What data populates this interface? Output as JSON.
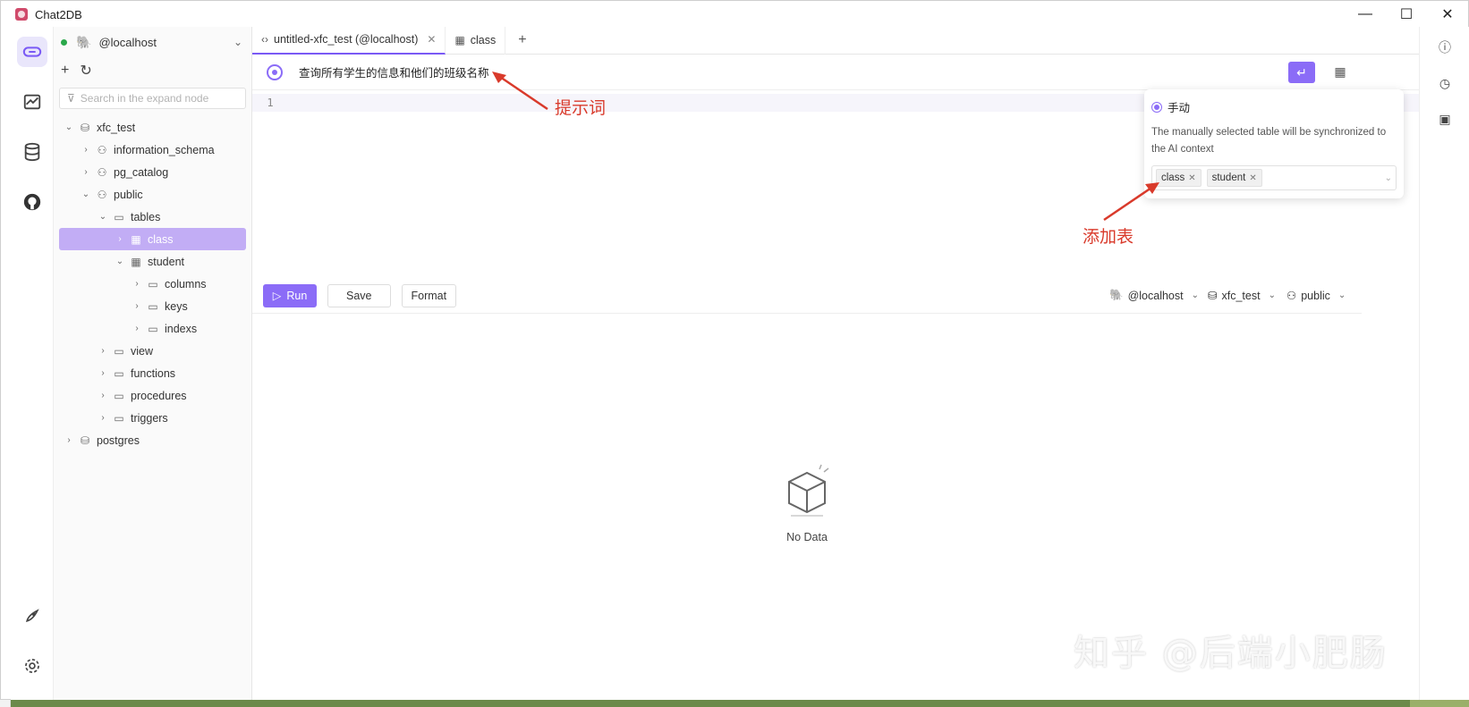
{
  "window": {
    "title": "Chat2DB",
    "minimize": "—",
    "maximize": "☐",
    "close": "✕"
  },
  "sidebar": {
    "connection": "@localhost",
    "search_placeholder": "Search in the expand node",
    "tree": [
      {
        "level": 0,
        "chev": "⌄",
        "icon": "database-icon",
        "glyph": "⛁",
        "label": "xfc_test"
      },
      {
        "level": 1,
        "chev": "›",
        "icon": "schema-icon",
        "glyph": "⚇",
        "label": "information_schema"
      },
      {
        "level": 1,
        "chev": "›",
        "icon": "schema-icon",
        "glyph": "⚇",
        "label": "pg_catalog"
      },
      {
        "level": 1,
        "chev": "⌄",
        "icon": "schema-icon",
        "glyph": "⚇",
        "label": "public"
      },
      {
        "level": 2,
        "chev": "⌄",
        "icon": "folder-icon",
        "glyph": "▭",
        "label": "tables"
      },
      {
        "level": 3,
        "chev": "›",
        "icon": "table-icon",
        "glyph": "▦",
        "label": "class",
        "selected": true
      },
      {
        "level": 3,
        "chev": "⌄",
        "icon": "table-icon",
        "glyph": "▦",
        "label": "student"
      },
      {
        "level": 4,
        "chev": "›",
        "icon": "folder-icon",
        "glyph": "▭",
        "label": "columns"
      },
      {
        "level": 4,
        "chev": "›",
        "icon": "folder-icon",
        "glyph": "▭",
        "label": "keys"
      },
      {
        "level": 4,
        "chev": "›",
        "icon": "folder-icon",
        "glyph": "▭",
        "label": "indexs"
      },
      {
        "level": 2,
        "chev": "›",
        "icon": "folder-icon",
        "glyph": "▭",
        "label": "view"
      },
      {
        "level": 2,
        "chev": "›",
        "icon": "folder-icon",
        "glyph": "▭",
        "label": "functions"
      },
      {
        "level": 2,
        "chev": "›",
        "icon": "folder-icon",
        "glyph": "▭",
        "label": "procedures"
      },
      {
        "level": 2,
        "chev": "›",
        "icon": "folder-icon",
        "glyph": "▭",
        "label": "triggers"
      },
      {
        "level": 0,
        "chev": "›",
        "icon": "database-icon",
        "glyph": "⛁",
        "label": "postgres"
      }
    ]
  },
  "tabs": [
    {
      "icon": "code-icon",
      "glyph": "‹›",
      "label": "untitled-xfc_test (@localhost)",
      "closable": true,
      "active": true
    },
    {
      "icon": "table-icon",
      "glyph": "▦",
      "label": "class",
      "closable": false,
      "active": false
    }
  ],
  "prompt": {
    "text": "查询所有学生的信息和他们的班级名称"
  },
  "editor": {
    "line_number": "1"
  },
  "toolbar": {
    "run": "Run",
    "save": "Save",
    "format": "Format",
    "connection": "@localhost",
    "database": "xfc_test",
    "schema": "public"
  },
  "empty": {
    "text": "No Data"
  },
  "popover": {
    "mode": "手动",
    "description": "The manually selected table will be synchronized to the AI context",
    "selected_tables": [
      "class",
      "student"
    ]
  },
  "annotations": {
    "prompt_label": "提示词",
    "add_table_label": "添加表"
  },
  "watermark": "知乎 @后端小肥肠",
  "colors": {
    "accent": "#8b6cf7",
    "selected_row": "#c2adf5",
    "annotation": "#d93a2b"
  }
}
